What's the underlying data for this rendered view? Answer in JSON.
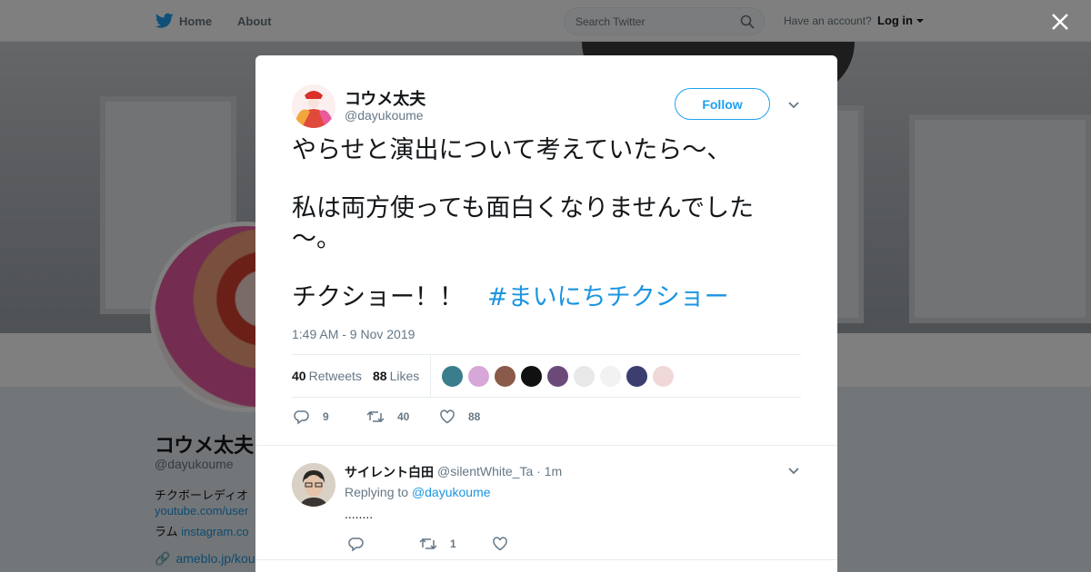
{
  "nav": {
    "home": "Home",
    "about": "About",
    "search_placeholder": "Search Twitter",
    "account_prompt": "Have an account?",
    "login": "Log in"
  },
  "profile": {
    "name": "コウメ太夫",
    "handle": "@dayukoume",
    "bio_line1": "チクボーレディオ",
    "bio_line2": "youtube.com/user",
    "bio_line3_prefix": "ラム ",
    "bio_line3_link": "instagram.co",
    "link": "ameblo.jp/kou"
  },
  "tweet": {
    "author_name": "コウメ太夫",
    "author_handle": "@dayukoume",
    "follow_label": "Follow",
    "para1": "やらせと演出について考えていたら～、",
    "para2": "私は両方使っても面白くなりませんでした～。",
    "para3_text": "チクショー！！",
    "hashtag": "#まいにちチクショー",
    "timestamp": "1:49 AM - 9 Nov 2019",
    "retweets_count": "40",
    "retweets_label": "Retweets",
    "likes_count": "88",
    "likes_label": "Likes",
    "reply_count": "9",
    "retweet_action_count": "40",
    "like_action_count": "88"
  },
  "likers": [
    {
      "name": "liker-1",
      "color": "#3a7d8c"
    },
    {
      "name": "liker-2",
      "color": "#d6a7d8"
    },
    {
      "name": "liker-3",
      "color": "#8a5a4a"
    },
    {
      "name": "liker-4",
      "color": "#111111"
    },
    {
      "name": "liker-5",
      "color": "#6b4a7a"
    },
    {
      "name": "liker-6",
      "color": "#e8e8e8"
    },
    {
      "name": "liker-7",
      "color": "#f2f2f2"
    },
    {
      "name": "liker-8",
      "color": "#3b3e6e"
    },
    {
      "name": "liker-9",
      "color": "#f0d8d8"
    }
  ],
  "reply": {
    "name": "サイレント白田",
    "handle_time": "@silentWhite_Ta · 1m",
    "replying_prefix": "Replying to",
    "replying_handle": "@dayukoume",
    "body": "........",
    "retweet_count": "1"
  },
  "colors": {
    "accent": "#1da1f2",
    "link": "#1b95e0",
    "muted": "#657786",
    "overlay": "rgba(0,0,0,0.5)"
  }
}
